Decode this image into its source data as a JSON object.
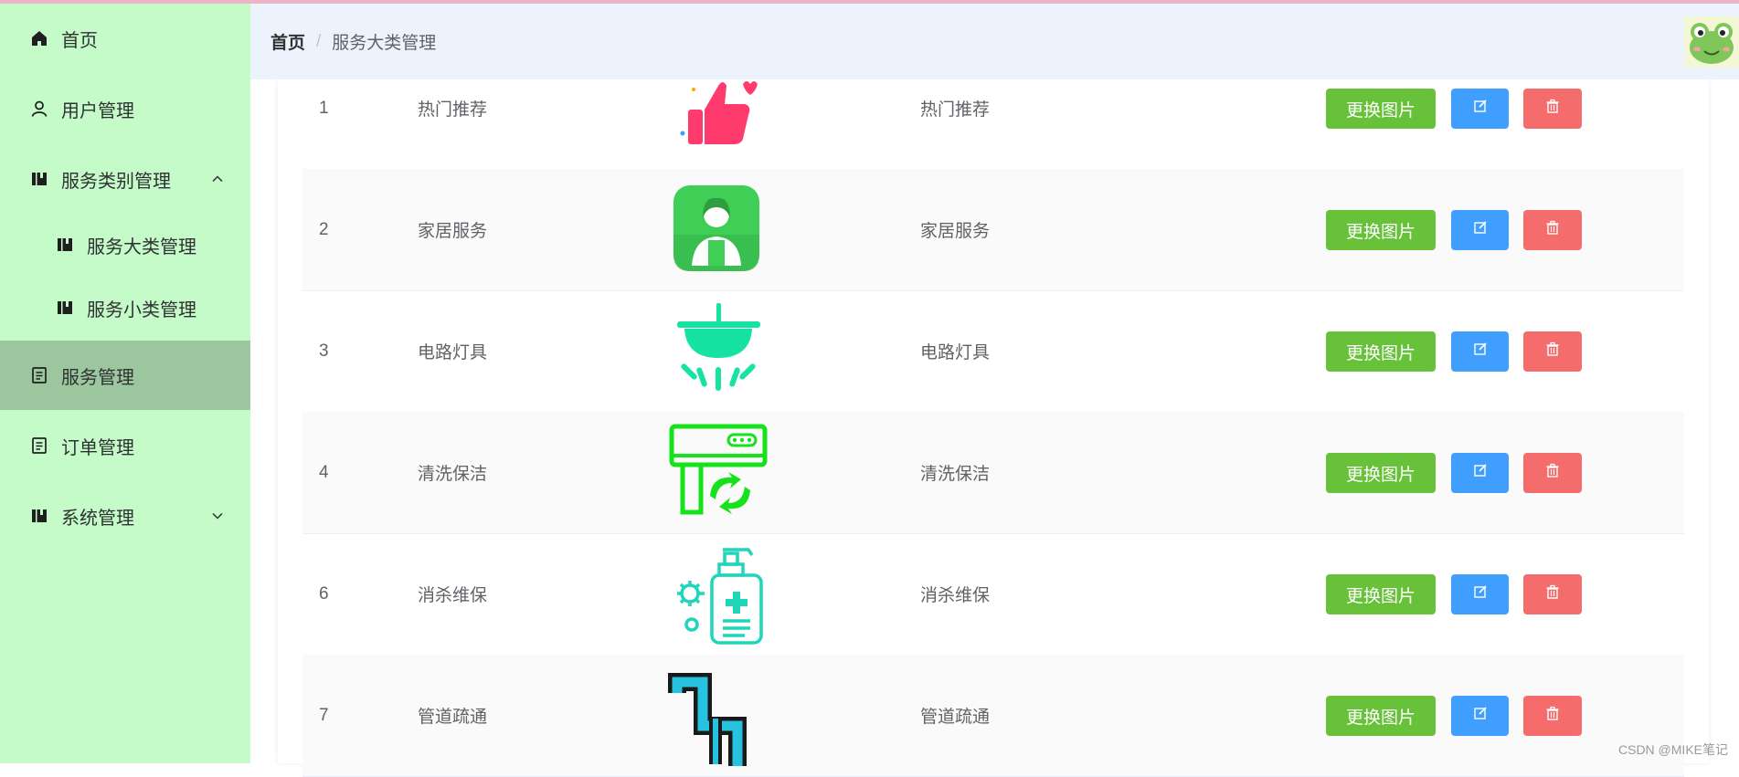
{
  "sidebar": {
    "items": [
      {
        "label": "首页",
        "icon": "home-icon"
      },
      {
        "label": "用户管理",
        "icon": "user-icon"
      },
      {
        "label": "服务类别管理",
        "icon": "book-icon",
        "arrow": "chevron-up-icon"
      },
      {
        "label": "服务大类管理",
        "icon": "book-icon"
      },
      {
        "label": "服务小类管理",
        "icon": "book-icon"
      },
      {
        "label": "服务管理",
        "icon": "document-icon",
        "active": true
      },
      {
        "label": "订单管理",
        "icon": "document-icon"
      },
      {
        "label": "系统管理",
        "icon": "book-icon",
        "arrow": "chevron-down-icon"
      }
    ]
  },
  "header": {
    "breadcrumb": {
      "home": "首页",
      "separator": "/",
      "current": "服务大类管理"
    },
    "avatar": "frog-avatar"
  },
  "table": {
    "rows": [
      {
        "id": "1",
        "name": "热门推荐",
        "name2": "热门推荐",
        "icon": "thumbs-up-heart-icon"
      },
      {
        "id": "2",
        "name": "家居服务",
        "name2": "家居服务",
        "icon": "housekeeper-icon"
      },
      {
        "id": "3",
        "name": "电路灯具",
        "name2": "电路灯具",
        "icon": "ceiling-lamp-icon"
      },
      {
        "id": "4",
        "name": "清洗保洁",
        "name2": "清洗保洁",
        "icon": "air-conditioner-clean-icon"
      },
      {
        "id": "6",
        "name": "消杀维保",
        "name2": "消杀维保",
        "icon": "sanitizer-virus-icon"
      },
      {
        "id": "7",
        "name": "管道疏通",
        "name2": "管道疏通",
        "icon": "pipe-icon"
      }
    ],
    "actions": {
      "change_image": "更换图片",
      "edit_icon": "edit-icon",
      "delete_icon": "delete-icon"
    }
  },
  "watermark": "CSDN @MIKE笔记",
  "colors": {
    "sidebar_bg": "#c4fbc9",
    "sidebar_active": "#9cc79e",
    "header_bg": "#edf3fc",
    "success": "#67c23a",
    "primary": "#409eff",
    "danger": "#f56c6c"
  }
}
